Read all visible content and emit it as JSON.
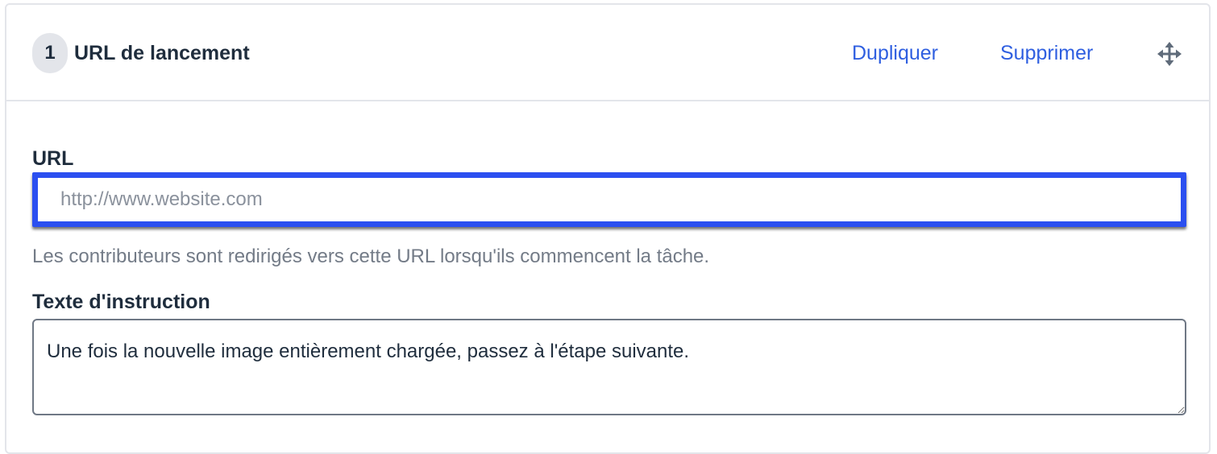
{
  "step": {
    "number": "1",
    "title": "URL de lancement"
  },
  "actions": {
    "duplicate_label": "Dupliquer",
    "delete_label": "Supprimer",
    "move_icon": "move-arrows-icon"
  },
  "url_field": {
    "label": "URL",
    "placeholder": "http://www.website.com",
    "value": "",
    "helper": "Les contributeurs sont redirigés vers cette URL lorsqu'ils commencent la tâche."
  },
  "instruction_field": {
    "label": "Texte d'instruction",
    "value": "Une fois la nouvelle image entièrement chargée, passez à l'étape suivante."
  },
  "colors": {
    "accent": "#2f5fe0",
    "focus_border": "#2b4ff0",
    "heading": "#1f2d3d",
    "muted": "#737b87"
  }
}
